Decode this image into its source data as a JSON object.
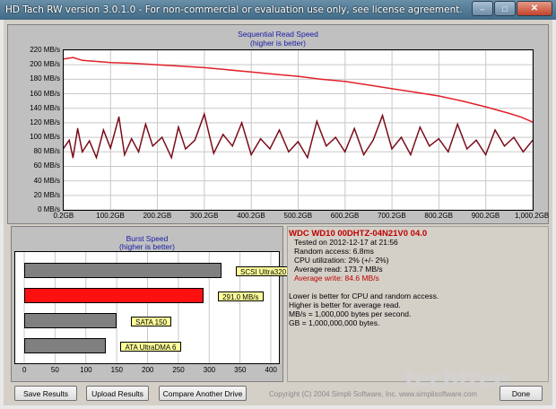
{
  "window": {
    "title": "HD Tach RW version 3.0.1.0  - For non-commercial or evaluation use only, see license agreement.",
    "min_glyph": "–",
    "max_glyph": "□",
    "close_glyph": "✕"
  },
  "seq_chart": {
    "title": "Sequential Read Speed",
    "subtitle": "(higher is better)"
  },
  "burst_chart": {
    "title": "Burst Speed",
    "subtitle": "(higher is better)"
  },
  "info": {
    "drive": "WDC WD10 00DHTZ-04N21V0 04.0",
    "tested_on": "Tested on 2012-12-17 at 21:56",
    "random_access": "Random access: 6.8ms",
    "cpu": "CPU utilization: 2% (+/- 2%)",
    "avg_read": "Average read: 173.7 MB/s",
    "avg_write": "Average write: 84.6 MB/s",
    "note1": "Lower is better for CPU and random access.",
    "note2": "Higher is better for average read.",
    "note3": "MB/s = 1,000,000 bytes per second.",
    "note4": "GB = 1,000,000,000 bytes."
  },
  "buttons": {
    "save": "Save Results",
    "upload": "Upload Results",
    "compare": "Compare Another Drive",
    "done": "Done"
  },
  "copyright": "Copyright (C) 2004 Simpli Software, Inc. www.simplisoftware.com",
  "watermark": "techtree",
  "colors": {
    "read_line": "#e2202a",
    "write_line": "#7a0d1a",
    "highlight_bar": "#ff1010",
    "reference_bar": "#808080",
    "title_text": "#1a1aa8",
    "drive_text": "#c00000"
  },
  "chart_data": [
    {
      "type": "line",
      "title": "Sequential Read Speed",
      "subtitle": "(higher is better)",
      "y_unit": "MB/s",
      "ylim": [
        0,
        220
      ],
      "y_ticks": [
        "0 MB/s",
        "20 MB/s",
        "40 MB/s",
        "60 MB/s",
        "80 MB/s",
        "100 MB/s",
        "120 MB/s",
        "140 MB/s",
        "160 MB/s",
        "180 MB/s",
        "200 MB/s",
        "220 MB/s"
      ],
      "x_ticks": [
        "0.2GB",
        "100.2GB",
        "200.2GB",
        "300.2GB",
        "400.2GB",
        "500.2GB",
        "600.2GB",
        "700.2GB",
        "800.2GB",
        "900.2GB",
        "1,000.2GB"
      ],
      "x_range_gb": [
        0.2,
        1000.2
      ],
      "grid": true,
      "series": [
        {
          "name": "Average read",
          "x": [
            0.2,
            20,
            40,
            60,
            80,
            100,
            150,
            200,
            250,
            300,
            350,
            400,
            450,
            500,
            550,
            600,
            650,
            700,
            750,
            800,
            850,
            900,
            950,
            975,
            1000.2
          ],
          "values": [
            208,
            210,
            206,
            205,
            204,
            203,
            202,
            200,
            198,
            196,
            193,
            190,
            187,
            184,
            180,
            177,
            172,
            167,
            162,
            157,
            150,
            142,
            133,
            128,
            121
          ]
        },
        {
          "name": "Average write",
          "x": [
            0.2,
            12,
            20,
            30,
            40,
            55,
            70,
            85,
            100,
            118,
            130,
            145,
            160,
            175,
            190,
            210,
            230,
            245,
            260,
            280,
            300,
            320,
            340,
            360,
            380,
            400,
            420,
            440,
            460,
            480,
            500,
            520,
            540,
            560,
            580,
            600,
            620,
            640,
            660,
            680,
            700,
            720,
            740,
            760,
            780,
            800,
            820,
            840,
            860,
            880,
            900,
            920,
            940,
            960,
            980,
            1000.2
          ],
          "values": [
            85,
            96,
            72,
            112,
            80,
            95,
            72,
            110,
            85,
            128,
            76,
            98,
            80,
            118,
            88,
            100,
            72,
            114,
            84,
            96,
            132,
            78,
            104,
            88,
            120,
            76,
            98,
            84,
            110,
            80,
            94,
            72,
            122,
            88,
            100,
            80,
            112,
            76,
            96,
            130,
            84,
            100,
            76,
            114,
            88,
            98,
            80,
            118,
            84,
            96,
            76,
            110,
            88,
            100,
            80,
            96
          ]
        }
      ]
    },
    {
      "type": "bar",
      "orientation": "horizontal",
      "title": "Burst Speed",
      "subtitle": "(higher is better)",
      "xlim": [
        0,
        400
      ],
      "x_ticks": [
        "0",
        "50",
        "100",
        "150",
        "200",
        "250",
        "300",
        "350",
        "400"
      ],
      "categories": [
        "SCSI Ultra320",
        "291.0 MB/s",
        "SATA 150",
        "ATA UltraDMA 6"
      ],
      "values": [
        320,
        291,
        150,
        133
      ]
    }
  ]
}
